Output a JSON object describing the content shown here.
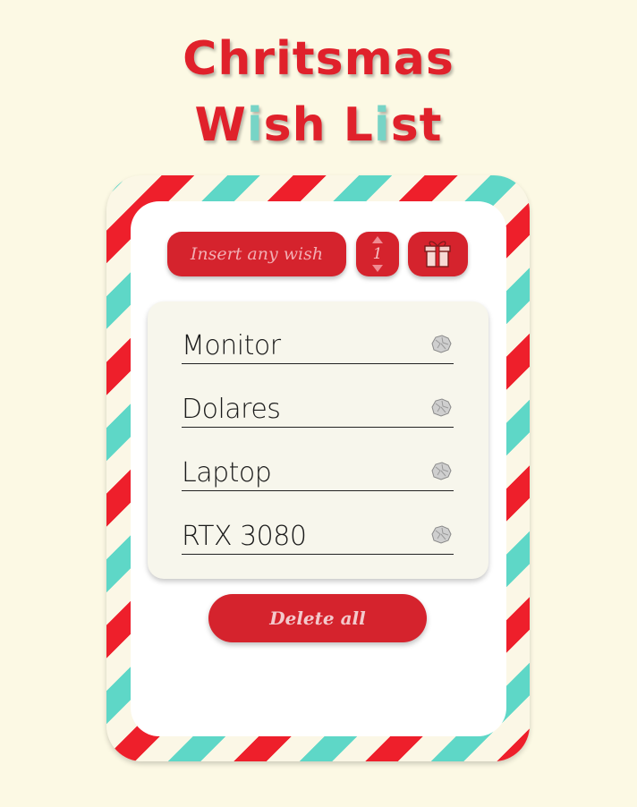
{
  "title": {
    "line1": "Chritsmas",
    "line2_part1": "W",
    "line2_part2": "i",
    "line2_part3": "sh L",
    "line2_part4": "i",
    "line2_part5": "st"
  },
  "form": {
    "wish_placeholder": "Insert any wish",
    "quantity": "1",
    "submit_icon": "gift-icon"
  },
  "wishes": [
    {
      "label": "Monitor",
      "remove_icon": "crumpled-paper-icon"
    },
    {
      "label": "Dolares",
      "remove_icon": "crumpled-paper-icon"
    },
    {
      "label": "Laptop",
      "remove_icon": "crumpled-paper-icon"
    },
    {
      "label": "RTX 3080",
      "remove_icon": "crumpled-paper-icon"
    }
  ],
  "actions": {
    "delete_all_label": "Delete all"
  },
  "colors": {
    "background": "#fcf9e4",
    "red": "#e0212b",
    "teal": "#5ed7c7",
    "button_red": "#d5232d"
  }
}
